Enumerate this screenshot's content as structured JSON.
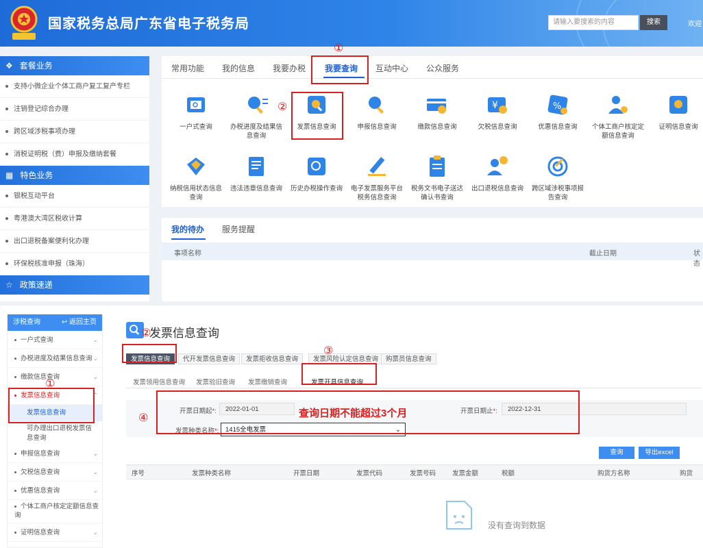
{
  "header": {
    "title": "国家税务总局广东省电子税务局",
    "search_placeholder": "请输入要搜索的内容",
    "search_button": "搜索",
    "welcome": "欢迎"
  },
  "sidebar": {
    "section1": "套餐业务",
    "items1": [
      "支持小微企业个体工商户复工复产专栏",
      "注销登记综合办理",
      "跨区域涉税事项办理",
      "消税证明税（费）申报及缴纳套餐"
    ],
    "section2": "特色业务",
    "items2": [
      "银税互动平台",
      "粤港澳大湾区税收计算",
      "出口退税备案便利化办理",
      "环保税核准申报（珠海）"
    ],
    "section3": "政策速递"
  },
  "tabs": [
    "常用功能",
    "我的信息",
    "我要办税",
    "我要查询",
    "互动中心",
    "公众服务"
  ],
  "active_tab": "我要查询",
  "functions_row1": [
    "一户式查询",
    "办税进度及结果信息查询",
    "发票信息查询",
    "申报信息查询",
    "缴款信息查询",
    "欠税信息查询",
    "优惠信息查询",
    "个体工商户核定定额信息查询",
    "证明信息查询"
  ],
  "functions_row2": [
    "纳税信用状态信息查询",
    "违法违章信息查询",
    "历史办税操作查询",
    "电子发票服务平台税务信息查询",
    "税务文书电子送达确认书查询",
    "出口退税信息查询",
    "跨区域涉税事项报告查询"
  ],
  "todo": {
    "tabs": [
      "我的待办",
      "服务提醒"
    ],
    "col_name": "事项名称",
    "col_deadline": "截止日期",
    "col_status": "状态"
  },
  "annotations": {
    "n1": "①",
    "n2": "②",
    "n3": "③",
    "n4": "④",
    "notice": "查询日期不能超过3个月"
  },
  "left_nav": {
    "head": "涉税查询",
    "back": "返回主页",
    "items": [
      "一户式查询",
      "办税进度及结果信息查询",
      "缴款信息查询",
      "发票信息查询"
    ],
    "sub": "发票信息查询",
    "sub2": "可办理出口退税发票信息查询",
    "items2": [
      "申报信息查询",
      "欠税信息查询",
      "优惠信息查询",
      "个体工商户核定定额信息查询",
      "证明信息查询"
    ]
  },
  "page": {
    "title": "发票信息查询",
    "tabs": [
      "发票信息查询",
      "代开发票信息查询",
      "发票拒收信息查询",
      "发票风险认定信息查询",
      "购票员信息查询"
    ],
    "subtabs": [
      "发票领用信息查询",
      "发票验旧查询",
      "发票缴销查询",
      "发票开具信息查询"
    ],
    "start_label": "开票日期起",
    "start_value": "2022-01-01",
    "end_label": "开票日期止",
    "end_value": "2022-12-31",
    "type_label": "发票种类名称",
    "type_value": "1415全电发票",
    "query_btn": "查询",
    "export_btn": "导出excel",
    "columns": [
      "序号",
      "发票种类名称",
      "开票日期",
      "发票代码",
      "发票号码",
      "发票金额",
      "税额",
      "购货方名称",
      "购货"
    ],
    "empty": "没有查询到数据"
  },
  "colors": {
    "primary": "#1e5fd6",
    "annotation_red": "#d91f1f",
    "header_blue": "#2f84e8"
  }
}
